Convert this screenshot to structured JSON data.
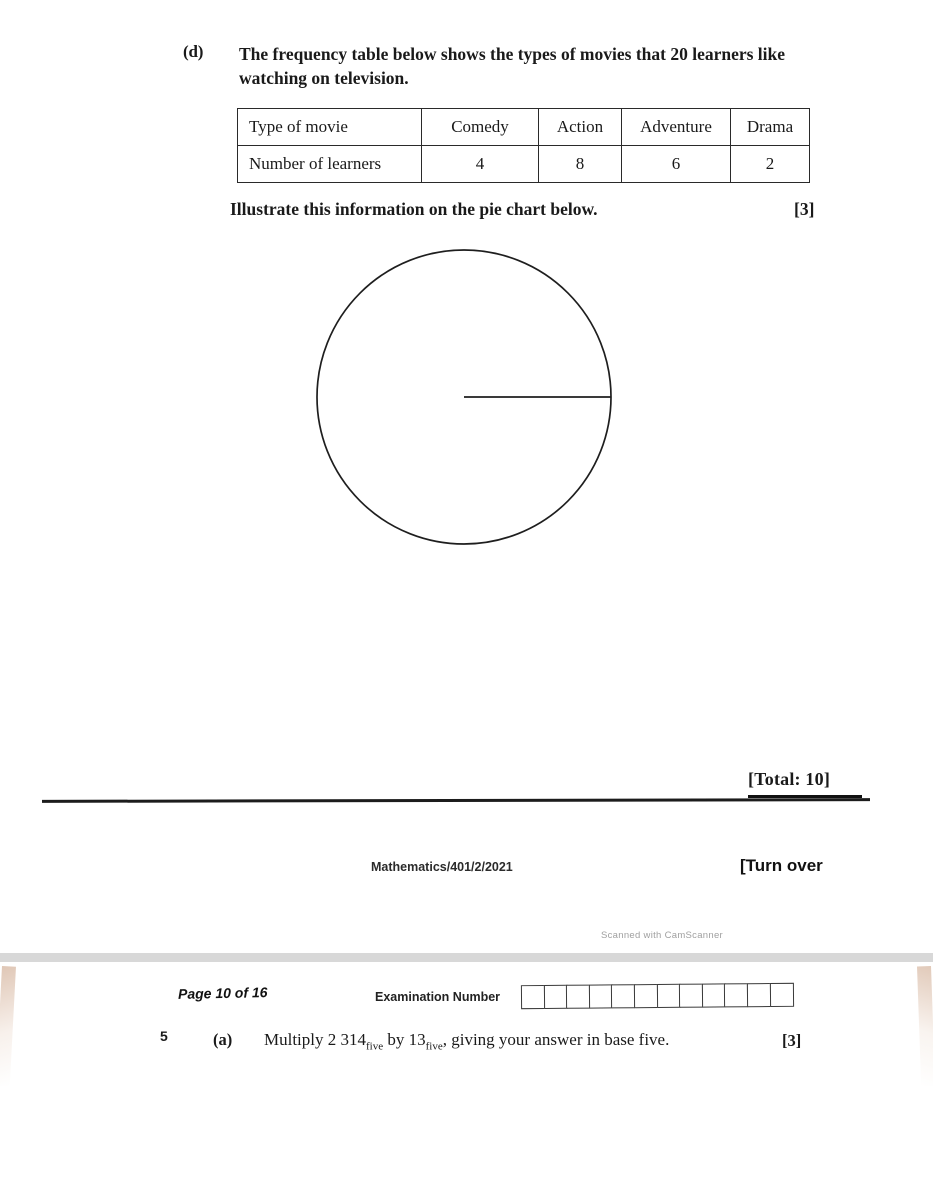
{
  "document": {
    "paper_code": "Mathematics/401/2/2021",
    "turn_over": "[Turn over",
    "watermark": "Scanned with CamScanner",
    "page_indicator": "Page 10 of 16",
    "exam_number_label": "Examination Number",
    "exam_number_boxes": 12,
    "total_label": "[Total: 10]"
  },
  "question_d": {
    "letter": "(d)",
    "stem": "The frequency table below shows the types of movies that 20 learners like watching on television.",
    "instruction": "Illustrate this information on the pie chart below.",
    "marks": "[3]"
  },
  "chart_data": {
    "type": "pie",
    "title": "",
    "categories": [
      "Comedy",
      "Action",
      "Adventure",
      "Drama"
    ],
    "values": [
      4,
      8,
      6,
      2
    ],
    "total": 20,
    "blank_template": true,
    "radius_line_angle_deg": 0,
    "center": [
      463,
      397
    ],
    "radius": 148
  },
  "table": {
    "row_labels": [
      "Type of movie",
      "Number of learners"
    ],
    "columns": [
      "Comedy",
      "Action",
      "Adventure",
      "Drama"
    ],
    "counts": [
      "4",
      "8",
      "6",
      "2"
    ]
  },
  "question_5a": {
    "number": "5",
    "letter": "(a)",
    "text_part1": "Multiply 2 314",
    "sub1": "five",
    "text_part2": " by 13",
    "sub2": "five",
    "text_part3": ", giving your answer in base five.",
    "marks": "[3]"
  }
}
